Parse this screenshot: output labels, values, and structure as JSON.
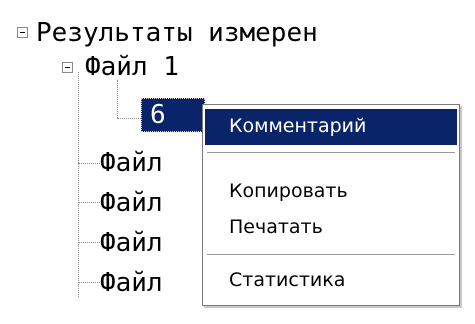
{
  "tree": {
    "root_label": "Результаты измерен",
    "file1_label": "Файл 1",
    "selected_label": "6",
    "file_label": "Файл"
  },
  "context_menu": {
    "comment": "Комментарий",
    "copy": "Копировать",
    "print": "Печатать",
    "stats": "Статистика"
  }
}
